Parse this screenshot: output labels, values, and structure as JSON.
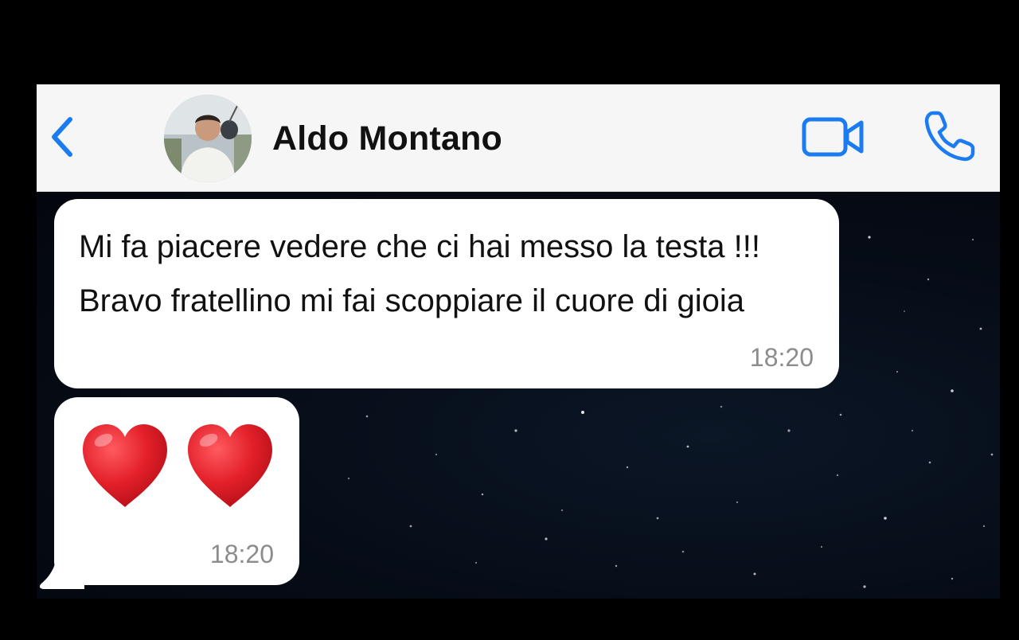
{
  "header": {
    "back_icon": "chevron-left-icon",
    "contact_name": "Aldo Montano",
    "video_icon": "video-camera-icon",
    "call_icon": "phone-icon",
    "accent": "#1a7cf0"
  },
  "messages": [
    {
      "text": "Mi fa piacere vedere che ci hai messo la testa !!! Bravo fratellino mi fai scoppiare il cuore di gioia",
      "time": "18:20"
    },
    {
      "text": "❤️ ❤️",
      "time": "18:20"
    }
  ],
  "colors": {
    "header_bg": "#f6f6f6",
    "bubble_bg": "#ffffff",
    "chat_bg": "#060b15",
    "heart": "#e3202a"
  }
}
